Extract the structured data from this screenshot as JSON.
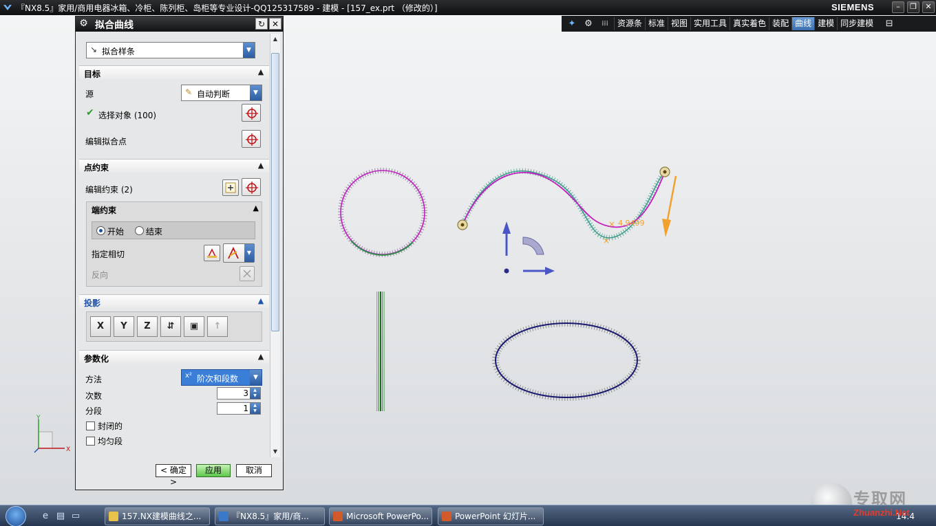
{
  "window": {
    "title": "『NX8.5』家用/商用电器冰箱、冷柜、陈列柜、岛柜等专业设计-QQ125317589 - 建模 - [157_ex.prt （修改的）]",
    "brand": "SIEMENS",
    "controls": [
      "–",
      "❐",
      "✕"
    ]
  },
  "toolbar": {
    "tabs": [
      "资源条",
      "标准",
      "视图",
      "实用工具",
      "真实着色",
      "装配",
      "曲线",
      "建模",
      "同步建模"
    ],
    "active_tab": "曲线"
  },
  "dialog": {
    "title": "拟合曲线",
    "type_value": "拟合样条",
    "target": {
      "header": "目标",
      "source_label": "源",
      "source_value": "自动判断",
      "select_objects_label": "选择对象 (100)",
      "edit_fit_points_label": "编辑拟合点"
    },
    "point_constraint": {
      "header": "点约束",
      "edit_constraint_label": "编辑约束 (2)",
      "end_constraint": {
        "header": "端约束",
        "start_label": "开始",
        "end_label": "结束",
        "selected": "开始",
        "specify_tangent_label": "指定相切",
        "reverse_label": "反向"
      }
    },
    "projection": {
      "header": "投影",
      "buttons": [
        "X",
        "Y",
        "Z",
        "⇵",
        "▣",
        "↑"
      ]
    },
    "parameterization": {
      "header": "参数化",
      "method_label": "方法",
      "method_value": "阶次和段数",
      "degree_label": "次数",
      "degree_value": "3",
      "segments_label": "分段",
      "segments_value": "1",
      "closed_label": "封闭的",
      "uniform_label": "均匀段"
    },
    "buttons": {
      "ok": "< 确定 >",
      "apply": "应用",
      "cancel": "取消"
    }
  },
  "viewport": {
    "deviation_label": "4.9499",
    "triad": {
      "x": "X",
      "y": "Y"
    }
  },
  "taskbar": {
    "items": [
      {
        "label": "157.NX建模曲线之...",
        "icon_color": "#e8c24a"
      },
      {
        "label": "『NX8.5』家用/商...",
        "icon_color": "#3a78c9"
      },
      {
        "label": "Microsoft PowerPo...",
        "icon_color": "#d25a2a"
      },
      {
        "label": "PowerPoint 幻灯片...",
        "icon_color": "#d25a2a"
      }
    ],
    "time": "14:4"
  },
  "watermark": {
    "text": "专取网",
    "url": "Zhuanzhi.Net"
  },
  "colors": {
    "accent_blue": "#2d5da0",
    "curve_magenta": "#c21fbe",
    "curve_teal": "#3a9a8a",
    "ellipse_navy": "#1a1a70",
    "vector_orange": "#f2a12e"
  }
}
